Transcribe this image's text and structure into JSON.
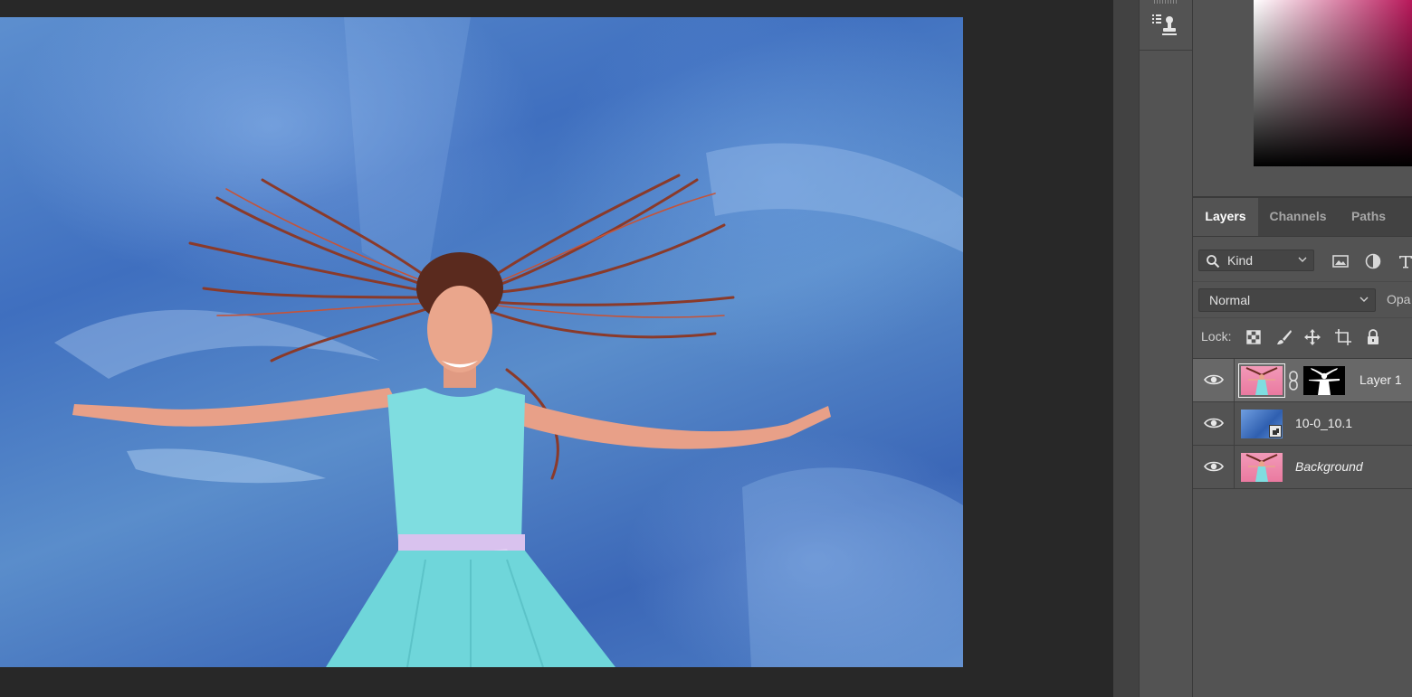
{
  "panel": {
    "tabs": [
      {
        "label": "Layers",
        "active": true
      },
      {
        "label": "Channels",
        "active": false
      },
      {
        "label": "Paths",
        "active": false
      }
    ],
    "filter": {
      "kind_label": "Kind",
      "icons": [
        "image-filter-icon",
        "adjustment-filter-icon",
        "type-filter-icon"
      ]
    },
    "blend_mode": "Normal",
    "opacity_label": "Opa",
    "lock_label": "Lock:",
    "lock_icons": [
      "lock-transparent-pixels-icon",
      "lock-image-pixels-icon",
      "lock-position-icon",
      "lock-artboard-icon",
      "lock-all-icon"
    ],
    "layers": [
      {
        "name": "Layer 1",
        "visible": true,
        "selected": true,
        "has_mask": true
      },
      {
        "name": "10-0_10.1",
        "visible": true,
        "selected": false,
        "smart_object": true
      },
      {
        "name": "Background",
        "visible": true,
        "selected": false,
        "italic": true
      }
    ]
  },
  "colors": {
    "picker_hue": "#b8185a",
    "panel_bg": "#535353",
    "selected_row": "#686868"
  }
}
